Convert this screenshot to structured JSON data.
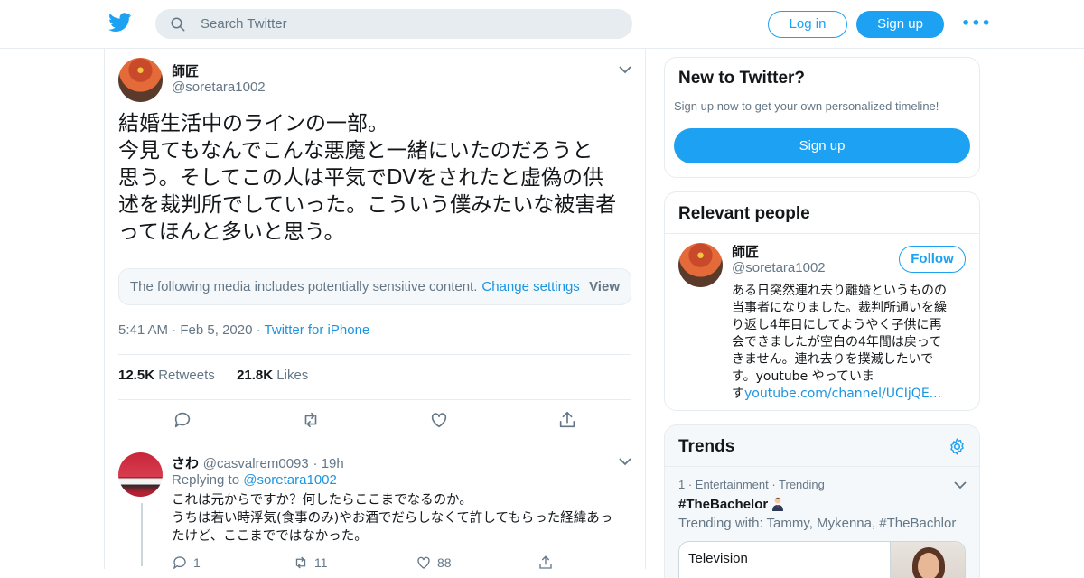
{
  "header": {
    "search_placeholder": "Search Twitter",
    "login_label": "Log in",
    "signup_label": "Sign up",
    "more_label": "•••",
    "accent_color": "#1da1f2"
  },
  "tweet": {
    "author_name": "師匠",
    "author_handle": "@soretara1002",
    "text_lines": [
      "結婚生活中のラインの一部。",
      "今見てもなんでこんな悪魔と一緒にいたのだろうと",
      "思う。そしてこの人は平気でDVをされたと虚偽の供",
      "述を裁判所でしていった。こういう僕みたいな被害者",
      "ってほんと多いと思う。"
    ],
    "sensitive_notice": "The following media includes potentially sensitive content.",
    "change_settings": "Change settings",
    "view_label": "View",
    "time": "5:41 AM",
    "date": "Feb 5, 2020",
    "source": "Twitter for iPhone",
    "retweets_count": "12.5K",
    "retweets_label": "Retweets",
    "likes_count": "21.8K",
    "likes_label": "Likes"
  },
  "reply": {
    "name": "さわ",
    "handle": "@casvalrem0093",
    "time": "19h",
    "replying_to_label": "Replying to",
    "replying_to_handle": "@soretara1002",
    "text_lines": [
      "これは元からですか？何したらここまでなるのか。",
      "うちは若い時浮気(食事のみ)やお酒でだらしなくて許してもらった経緯あっ",
      "たけど、ここまでではなかった。"
    ],
    "reply_count": "1",
    "retweet_count": "11",
    "like_count": "88"
  },
  "sidebar": {
    "new_to_twitter": {
      "title": "New to Twitter?",
      "subtitle": "Sign up now to get your own personalized timeline!",
      "signup_label": "Sign up"
    },
    "relevant_people": {
      "title": "Relevant people",
      "name": "師匠",
      "handle": "@soretara1002",
      "follow_label": "Follow",
      "bio_lines": [
        "ある日突然連れ去り離婚というものの",
        "当事者になりました。裁判所通いを繰",
        "り返し4年目にしてようやく子供に再",
        "会できましたが空白の4年間は戻って",
        "きません。連れ去りを撲滅したいで",
        "す。youtube やっていま"
      ],
      "bio_last_prefix": "す",
      "bio_link": "youtube.com/channel/UCIjQE..."
    },
    "trends": {
      "title": "Trends",
      "item": {
        "meta": "1 · Entertainment · Trending",
        "hashtag": "#TheBachelor",
        "trending_with": "Trending with: Tammy, Mykenna, #TheBachlor",
        "media_label": "Television"
      }
    }
  }
}
